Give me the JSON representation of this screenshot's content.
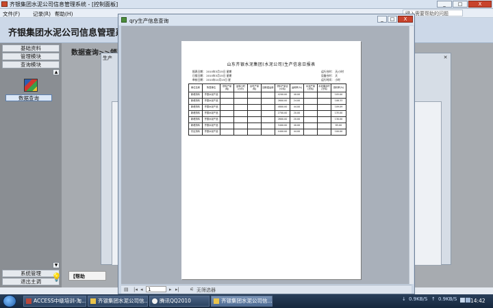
{
  "window": {
    "title": "齐银集团水泥公司信息管理系统 - [控制面板]",
    "buttons": {
      "minimize": "_",
      "maximize": "□",
      "close": "X"
    }
  },
  "menubar": {
    "items": [
      "文件(F)",
      "记录(R)",
      "帮助(H)"
    ],
    "help_placeholder": "键入需要帮助的问题"
  },
  "app": {
    "title": "齐银集团水泥公司信息管理系统"
  },
  "leftnav": {
    "top_items": [
      "基础资料",
      "管理模块",
      "查询模块"
    ],
    "selected_label": "数据查询",
    "bottom_items": [
      "系统管理",
      "退出主调"
    ]
  },
  "main": {
    "title": "数据查询>>领导",
    "bg_form_title": "生产",
    "hint": "【帮助"
  },
  "query_window": {
    "title": "qry生产信息查询",
    "page_number": "1",
    "filter_text": "无筛选器"
  },
  "report": {
    "title": "山东齐银水泥集团(水泥公司)生产信息日报表",
    "meta_left": [
      "报表日期：  2010年3月15日 星期",
      "日报日期：  2010年3月15日 星期",
      "审核日期：  2010年10月15日 星"
    ],
    "meta_right": [
      "运行台时：  天/小时",
      "设备台时：  天",
      "运行时间：  小时"
    ],
    "columns": [
      "单位名称",
      "所属单位",
      "熟料产量(吨)",
      "运转小时(小时)",
      "台时产量(吨)",
      "回转窑运转",
      "熟料产量合计(吨)",
      "运转率(%)",
      "水泥产量(万吨)",
      "水泥磨台时(万吨)",
      "熟料率(%)"
    ],
    "rows": [
      [
        "新峰熟料",
        "齐银水泥产品",
        "",
        "",
        "",
        "",
        "4200.00",
        "40.00",
        "",
        "",
        "105.00"
      ],
      [
        "新峰熟料",
        "齐银水泥产品",
        "",
        "",
        "",
        "",
        "2600.00",
        "24.00",
        "",
        "",
        "108.33"
      ],
      [
        "新峰熟料",
        "齐银水泥产品",
        "",
        "",
        "",
        "",
        "4800.00",
        "44.00",
        "",
        "",
        "109.09"
      ],
      [
        "新峰熟料",
        "齐银水泥产品",
        "",
        "",
        "",
        "",
        "2700.00",
        "20.00",
        "",
        "",
        "135.00"
      ],
      [
        "新峰熟料",
        "齐银水泥产品",
        "",
        "",
        "",
        "",
        "2600.00",
        "20.00",
        "",
        "",
        "130.00"
      ],
      [
        "新峰熟料",
        "齐银水泥产品",
        "",
        "",
        "",
        "",
        "3400.00",
        "40.00",
        "",
        "",
        "85.00"
      ],
      [
        "东区熟料",
        "齐银水泥产品",
        "",
        "",
        "",
        "",
        "4400.00",
        "44.00",
        "",
        "",
        "100.00"
      ]
    ]
  },
  "taskbar": {
    "tasks": [
      "ACCESS中级培训-淘...",
      "齐银集团水泥公司信...",
      "腾讯QQ2010",
      "齐银集团水泥公司信..."
    ],
    "net_down": "0.9KB/S",
    "net_up": "0.9KB/S",
    "clock": "14:42"
  }
}
